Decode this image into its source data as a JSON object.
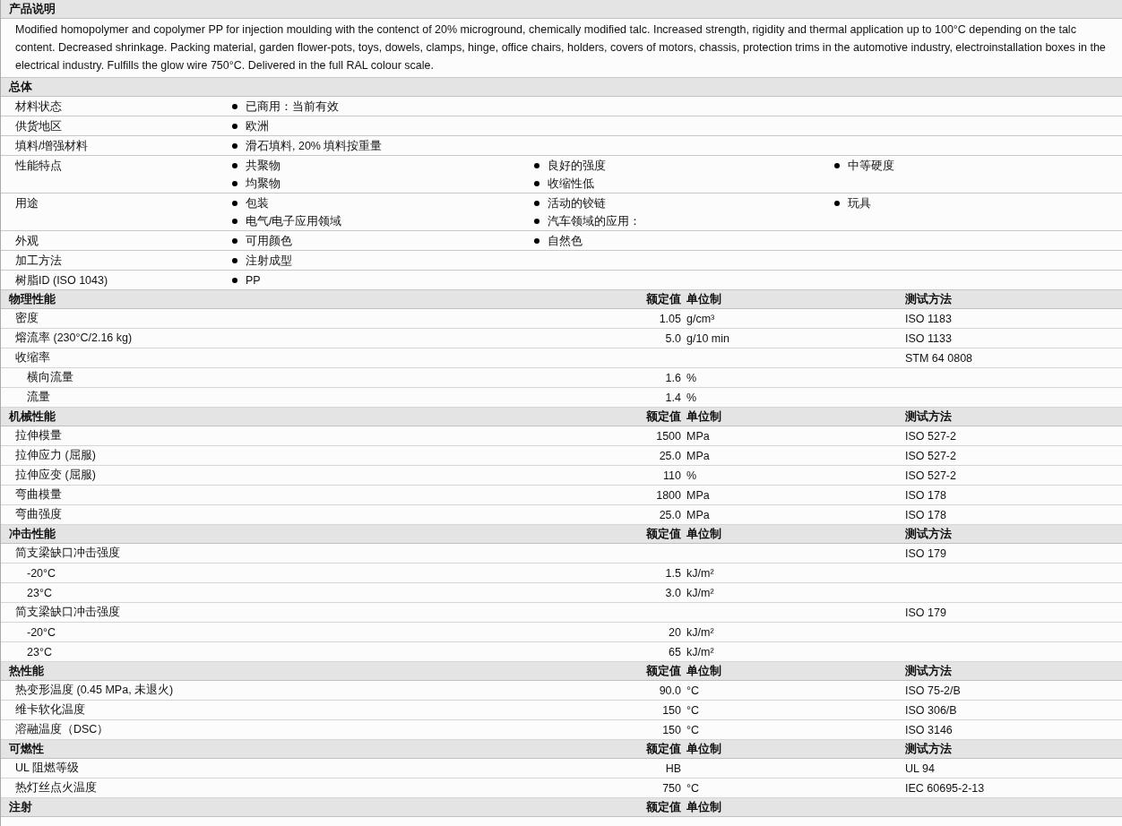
{
  "description": {
    "title": "产品说明",
    "text": "Modified homopolymer and copolymer PP for injection moulding with the contenct of 20% microground, chemically modified talc. Increased strength, rigidity and thermal application up to 100°C depending on the talc content. Decreased shrinkage. Packing material, garden flower-pots, toys, dowels, clamps, hinge, office chairs, holders, covers of motors, chassis, protection trims in the automotive industry, electroinstallation boxes in the electrical industry. Fulfills the glow wire 750°C. Delivered in the full RAL colour scale."
  },
  "general": {
    "title": "总体",
    "rows": [
      {
        "label": "材料状态",
        "columns": [
          [
            "已商用：当前有效"
          ]
        ]
      },
      {
        "label": "供货地区",
        "columns": [
          [
            "欧洲"
          ]
        ]
      },
      {
        "label": "填料/增强材料",
        "columns": [
          [
            "滑石填料, 20% 填料按重量"
          ]
        ]
      },
      {
        "label": "性能特点",
        "columns": [
          [
            "共聚物",
            "均聚物"
          ],
          [
            "良好的强度",
            "收缩性低"
          ],
          [
            "中等硬度"
          ]
        ]
      },
      {
        "label": "用途",
        "columns": [
          [
            "包装",
            "电气/电子应用领域"
          ],
          [
            "活动的铰链",
            "汽车领域的应用："
          ],
          [
            "玩具"
          ]
        ]
      },
      {
        "label": "外观",
        "columns": [
          [
            "可用颜色"
          ],
          [
            "自然色"
          ]
        ]
      },
      {
        "label": "加工方法",
        "columns": [
          [
            "注射成型"
          ]
        ]
      },
      {
        "label": "树脂ID (ISO 1043)",
        "columns": [
          [
            "PP"
          ]
        ]
      }
    ]
  },
  "sections": [
    {
      "title": "物理性能",
      "columns": {
        "value": "额定值",
        "unit": "单位制",
        "method": "测试方法"
      },
      "rows": [
        {
          "label": "密度",
          "value": "1.05",
          "unit": "g/cm³",
          "method": "ISO 1183"
        },
        {
          "label": "熔流率  (230°C/2.16 kg)",
          "value": "5.0",
          "unit": "g/10 min",
          "method": "ISO 1133"
        },
        {
          "label": "收缩率",
          "method": "STM 64 0808",
          "children": [
            {
              "label": "横向流量",
              "value": "1.6",
              "unit": "%"
            },
            {
              "label": "流量",
              "value": "1.4",
              "unit": "%"
            }
          ]
        }
      ]
    },
    {
      "title": "机械性能",
      "columns": {
        "value": "额定值",
        "unit": "单位制",
        "method": "测试方法"
      },
      "rows": [
        {
          "label": "拉伸模量",
          "value": "1500",
          "unit": "MPa",
          "method": "ISO 527-2"
        },
        {
          "label": "拉伸应力  (屈服)",
          "value": "25.0",
          "unit": "MPa",
          "method": "ISO 527-2"
        },
        {
          "label": "拉伸应变  (屈服)",
          "value": "110",
          "unit": "%",
          "method": "ISO 527-2"
        },
        {
          "label": "弯曲模量",
          "value": "1800",
          "unit": "MPa",
          "method": "ISO 178"
        },
        {
          "label": "弯曲强度",
          "value": "25.0",
          "unit": "MPa",
          "method": "ISO 178"
        }
      ]
    },
    {
      "title": "冲击性能",
      "columns": {
        "value": "额定值",
        "unit": "单位制",
        "method": "测试方法"
      },
      "rows": [
        {
          "label": "简支梁缺口冲击强度",
          "method": "ISO 179",
          "children": [
            {
              "label": "-20°C",
              "value": "1.5",
              "unit": "kJ/m²"
            },
            {
              "label": "23°C",
              "value": "3.0",
              "unit": "kJ/m²"
            }
          ]
        },
        {
          "label": "简支梁缺口冲击强度",
          "method": "ISO 179",
          "children": [
            {
              "label": "-20°C",
              "value": "20",
              "unit": "kJ/m²"
            },
            {
              "label": "23°C",
              "value": "65",
              "unit": "kJ/m²"
            }
          ]
        }
      ]
    },
    {
      "title": "热性能",
      "columns": {
        "value": "额定值",
        "unit": "单位制",
        "method": "测试方法"
      },
      "rows": [
        {
          "label": "热变形温度  (0.45 MPa, 未退火)",
          "value": "90.0",
          "unit": "°C",
          "method": "ISO 75-2/B"
        },
        {
          "label": "维卡软化温度",
          "value": "150",
          "unit": "°C",
          "method": "ISO 306/B"
        },
        {
          "label": "溶融温度（DSC）",
          "value": "150",
          "unit": "°C",
          "method": "ISO 3146"
        }
      ]
    },
    {
      "title": "可燃性",
      "columns": {
        "value": "额定值",
        "unit": "单位制",
        "method": "测试方法"
      },
      "rows": [
        {
          "label": "UL 阻燃等级",
          "value": "HB",
          "method": "UL 94"
        },
        {
          "label": "热灯丝点火温度",
          "value": "750",
          "unit": "°C",
          "method": "IEC 60695-2-13"
        }
      ]
    },
    {
      "title": "注射",
      "columns": {
        "value": "额定值",
        "unit": "单位制"
      }
    }
  ]
}
